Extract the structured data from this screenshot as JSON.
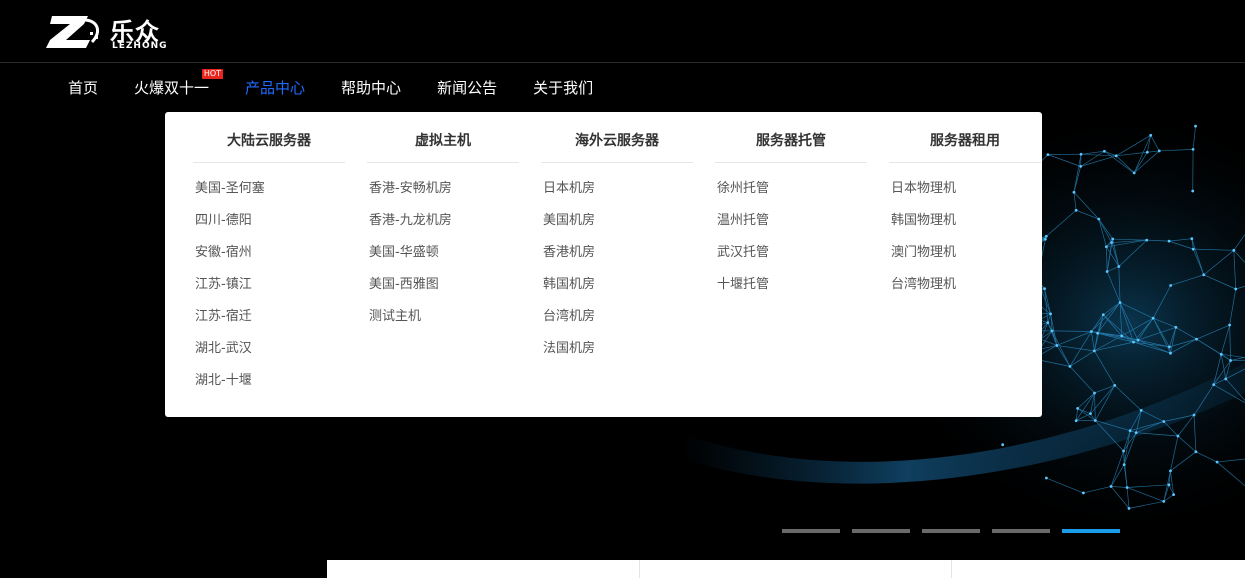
{
  "brand": {
    "name_cn": "乐众",
    "name_en": "LEZHONG"
  },
  "nav": {
    "items": [
      {
        "label": "首页"
      },
      {
        "label": "火爆双十一",
        "badge": "HOT"
      },
      {
        "label": "产品中心",
        "active": true
      },
      {
        "label": "帮助中心"
      },
      {
        "label": "新闻公告"
      },
      {
        "label": "关于我们"
      }
    ]
  },
  "dropdown": {
    "columns": [
      {
        "title": "大陆云服务器",
        "items": [
          "美国-圣何塞",
          "四川-德阳",
          "安徽-宿州",
          "江苏-镇江",
          "江苏-宿迁",
          "湖北-武汉",
          "湖北-十堰"
        ]
      },
      {
        "title": "虚拟主机",
        "items": [
          "香港-安畅机房",
          "香港-九龙机房",
          "美国-华盛顿",
          "美国-西雅图",
          "测试主机"
        ]
      },
      {
        "title": "海外云服务器",
        "items": [
          "日本机房",
          "美国机房",
          "香港机房",
          "韩国机房",
          "台湾机房",
          "法国机房"
        ]
      },
      {
        "title": "服务器托管",
        "items": [
          "徐州托管",
          "温州托管",
          "武汉托管",
          "十堰托管"
        ]
      },
      {
        "title": "服务器租用",
        "items": [
          "日本物理机",
          "韩国物理机",
          "澳门物理机",
          "台湾物理机"
        ]
      }
    ]
  },
  "slider": {
    "count": 5,
    "active_index": 4
  },
  "colors": {
    "accent": "#1f6bff",
    "dot_active": "#1a9ce8",
    "hot": "#e8261e"
  }
}
